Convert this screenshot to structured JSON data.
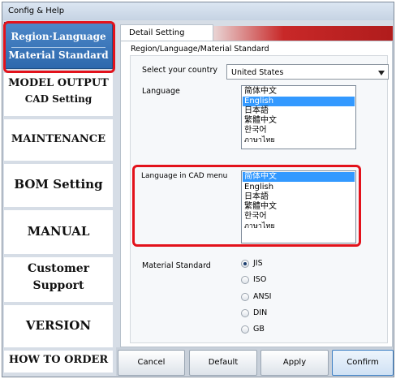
{
  "window": {
    "title": "Config & Help"
  },
  "nav": {
    "active": {
      "line1": "Region·Language",
      "line2": "Material Standard"
    },
    "items": [
      {
        "line1": "MODEL OUTPUT",
        "line2": "CAD Setting"
      },
      {
        "line1": "MAINTENANCE"
      },
      {
        "line1": "BOM Setting"
      },
      {
        "line1": "MANUAL"
      },
      {
        "line1": "Customer",
        "line2": "Support"
      },
      {
        "line1": "VERSION"
      },
      {
        "line1": "HOW TO ORDER"
      }
    ]
  },
  "main": {
    "tab_label": "Detail Setting",
    "section_label": "Region/Language/Material Standard",
    "country": {
      "label": "Select your country",
      "value": "United States"
    },
    "language": {
      "label": "Language",
      "options": [
        "简体中文",
        "English",
        "日本語",
        "繁體中文",
        "한국어",
        "ภาษาไทย"
      ],
      "selected": "English"
    },
    "cad_language": {
      "label": "Language in CAD menu",
      "options": [
        "简体中文",
        "English",
        "日本語",
        "繁體中文",
        "한국어",
        "ภาษาไทย"
      ],
      "selected": "简体中文"
    },
    "material": {
      "label": "Material Standard",
      "options": [
        "JIS",
        "ISO",
        "ANSI",
        "DIN",
        "GB"
      ],
      "selected": "JIS"
    }
  },
  "buttons": {
    "cancel": "Cancel",
    "default": "Default",
    "apply": "Apply",
    "confirm": "Confirm"
  },
  "colors": {
    "highlight_box": "#e3121b",
    "active_nav": "#3a78bd",
    "selection": "#3399ff"
  }
}
